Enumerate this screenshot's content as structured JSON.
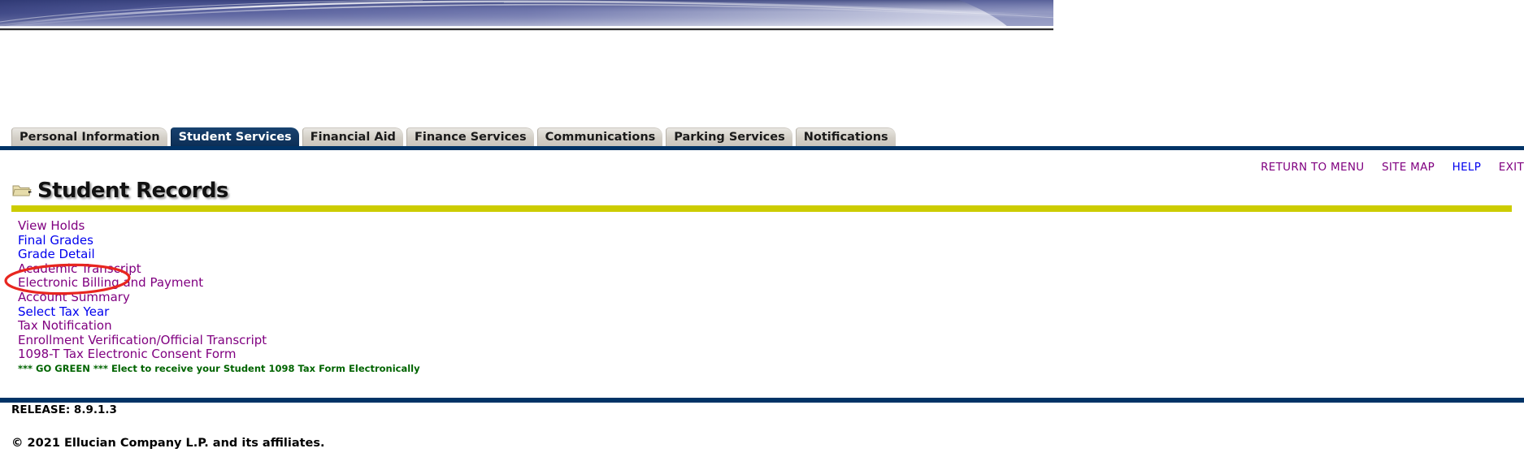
{
  "banner": {
    "name": "decorative-blue-swoosh-banner",
    "colors": {
      "deep_blue": "#3f4a8c",
      "mid_blue": "#5a63a0",
      "light": "#e9ebf5",
      "white": "#ffffff",
      "edge_dark": "#1b2340"
    }
  },
  "tabs": [
    {
      "label": "Personal Information",
      "active": false
    },
    {
      "label": "Student Services",
      "active": true
    },
    {
      "label": "Financial Aid",
      "active": false
    },
    {
      "label": "Finance Services",
      "active": false
    },
    {
      "label": "Communications",
      "active": false
    },
    {
      "label": "Parking Services",
      "active": false
    },
    {
      "label": "Notifications",
      "active": false
    }
  ],
  "utility_nav": [
    {
      "label": "RETURN TO MENU",
      "state": "visited"
    },
    {
      "label": "SITE MAP",
      "state": "visited"
    },
    {
      "label": "HELP",
      "state": "unvisited"
    },
    {
      "label": "EXIT",
      "state": "visited"
    }
  ],
  "header": {
    "title": "Student Records",
    "icon": "folder-icon",
    "divider_color": "#cccc00"
  },
  "menu": {
    "items": [
      {
        "label": "View Holds",
        "state": "visited"
      },
      {
        "label": "Final Grades",
        "state": "unvisited"
      },
      {
        "label": "Grade Detail",
        "state": "unvisited"
      },
      {
        "label": "Academic Transcript",
        "state": "visited",
        "highlighted": true
      },
      {
        "label": "Electronic Billing and Payment",
        "state": "visited"
      },
      {
        "label": "Account Summary",
        "state": "visited"
      },
      {
        "label": "Select Tax Year",
        "state": "unvisited"
      },
      {
        "label": "Tax Notification",
        "state": "visited"
      },
      {
        "label": "Enrollment Verification/Official Transcript",
        "state": "visited"
      },
      {
        "label": "1098-T Tax Electronic Consent Form",
        "state": "visited"
      }
    ],
    "note": "*** GO GREEN *** Elect to receive your Student 1098 Tax Form Electronically",
    "note_color": "#006400"
  },
  "annotation": {
    "type": "red-ellipse",
    "target": "Academic Transcript",
    "color": "#e8261f"
  },
  "footer": {
    "release": "RELEASE: 8.9.1.3",
    "copyright": "© 2021 Ellucian Company L.P. and its affiliates.",
    "rule_color": "#003366"
  },
  "colors": {
    "navy": "#003366",
    "tab_active_bg": "#0f3460",
    "tab_inactive_bg": "#d4d0c8",
    "link_visited": "#800080",
    "link_unvisited": "#0000ee",
    "yellow": "#cccc00",
    "green": "#006400"
  }
}
